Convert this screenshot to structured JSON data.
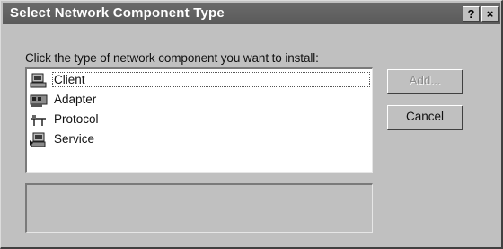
{
  "window": {
    "title": "Select Network Component Type",
    "help_glyph": "?",
    "close_glyph": "×"
  },
  "instruction": "Click the type of network component you want to install:",
  "components": [
    {
      "label": "Client",
      "icon": "client-icon",
      "selected": true
    },
    {
      "label": "Adapter",
      "icon": "adapter-icon",
      "selected": false
    },
    {
      "label": "Protocol",
      "icon": "protocol-icon",
      "selected": false
    },
    {
      "label": "Service",
      "icon": "service-icon",
      "selected": false
    }
  ],
  "buttons": {
    "add_label": "Add...",
    "add_enabled": false,
    "cancel_label": "Cancel"
  },
  "description": ""
}
